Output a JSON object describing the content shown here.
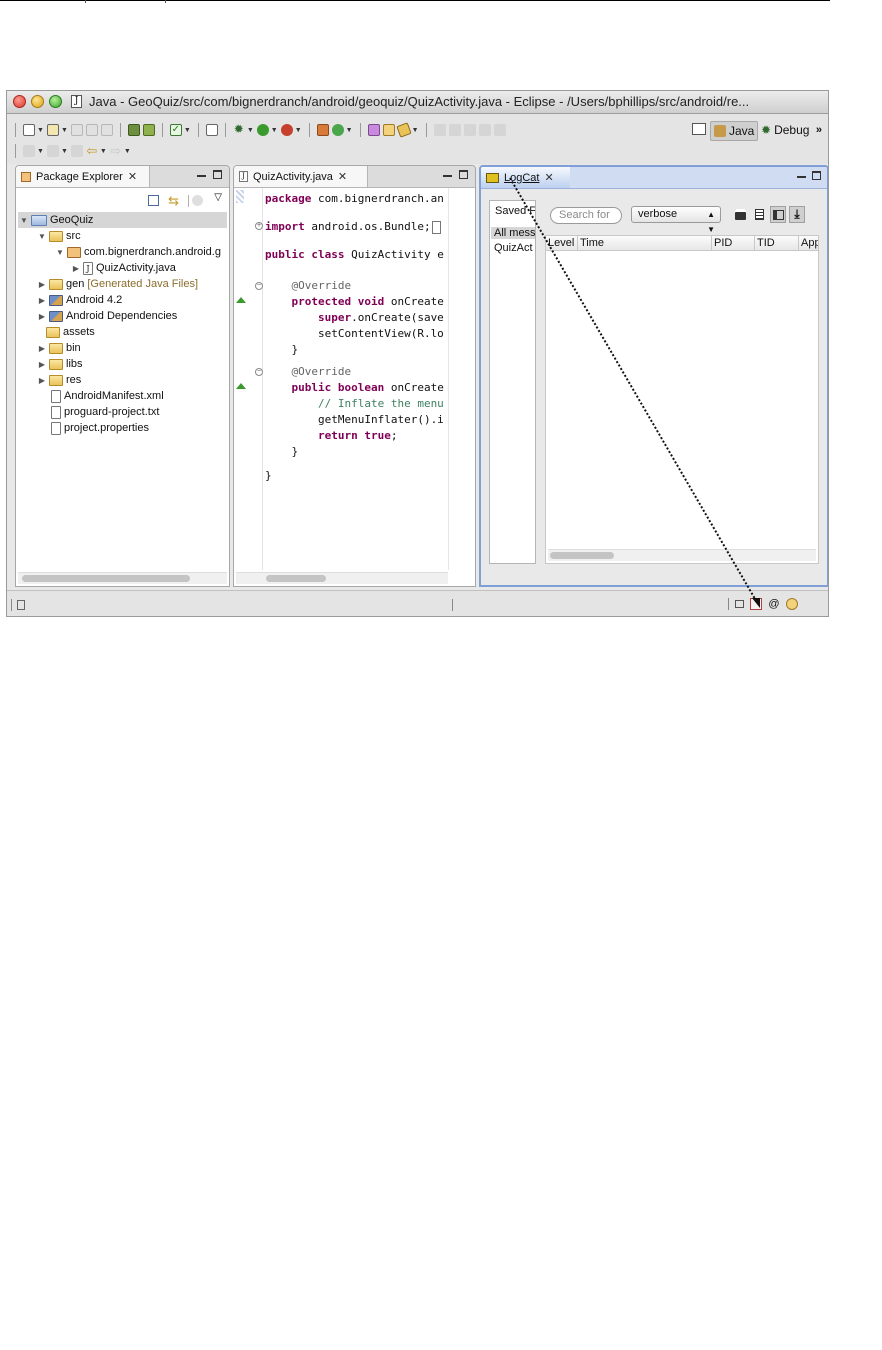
{
  "window": {
    "title": "Java - GeoQuiz/src/com/bignerdranch/android/geoquiz/QuizActivity.java - Eclipse - /Users/bphillips/src/android/re...",
    "title_icon": "J"
  },
  "perspectives": {
    "java_label": "Java",
    "debug_label": "Debug",
    "more": "»"
  },
  "package_explorer": {
    "tab_label": "Package Explorer",
    "tree": [
      {
        "label": "GeoQuiz",
        "icon": "project-icon"
      },
      {
        "label": "src",
        "icon": "source-folder-icon"
      },
      {
        "label": "com.bignerdranch.android.g",
        "icon": "package-icon"
      },
      {
        "label": "QuizActivity.java",
        "icon": "java-file-icon"
      },
      {
        "label": "gen",
        "suffix": "[Generated Java Files]",
        "icon": "source-folder-icon"
      },
      {
        "label": "Android 4.2",
        "icon": "library-icon"
      },
      {
        "label": "Android Dependencies",
        "icon": "library-icon"
      },
      {
        "label": "assets",
        "icon": "folder-icon"
      },
      {
        "label": "bin",
        "icon": "folder-icon"
      },
      {
        "label": "libs",
        "icon": "folder-icon"
      },
      {
        "label": "res",
        "icon": "folder-icon"
      },
      {
        "label": "AndroidManifest.xml",
        "icon": "xml-file-icon"
      },
      {
        "label": "proguard-project.txt",
        "icon": "text-file-icon"
      },
      {
        "label": "project.properties",
        "icon": "text-file-icon"
      }
    ]
  },
  "editor": {
    "tab_label": "QuizActivity.java",
    "lines": {
      "l1_kw": "package",
      "l1_rest": " com.bignerdranch.an",
      "l2_kw": "import",
      "l2_rest": " android.os.Bundle;",
      "l3_kw": "public class",
      "l3_rest": " QuizActivity e",
      "l4": "    @Override",
      "l5_kw": "    protected void",
      "l5_rest": " onCreate",
      "l6_kw": "        super",
      "l6_rest": ".onCreate(save",
      "l7": "        setContentView(R.lo",
      "l8": "    }",
      "l9": "    @Override",
      "l10_kw": "    public boolean",
      "l10_rest": " onCreate",
      "l11": "        // Inflate the menu",
      "l12": "        getMenuInflater().i",
      "l13_kw": "        return true",
      "l13_rest": ";",
      "l14": "    }",
      "l15": "}"
    }
  },
  "logcat": {
    "tab_label": "LogCat",
    "saved_filters_header": "Saved Fi",
    "filters": [
      "All mess",
      "QuizAct"
    ],
    "search_placeholder": "Search for",
    "level_select": "verbose",
    "columns": [
      "Level",
      "Time",
      "PID",
      "TID",
      "App"
    ]
  },
  "statusbar": {
    "trim_email": "@"
  }
}
